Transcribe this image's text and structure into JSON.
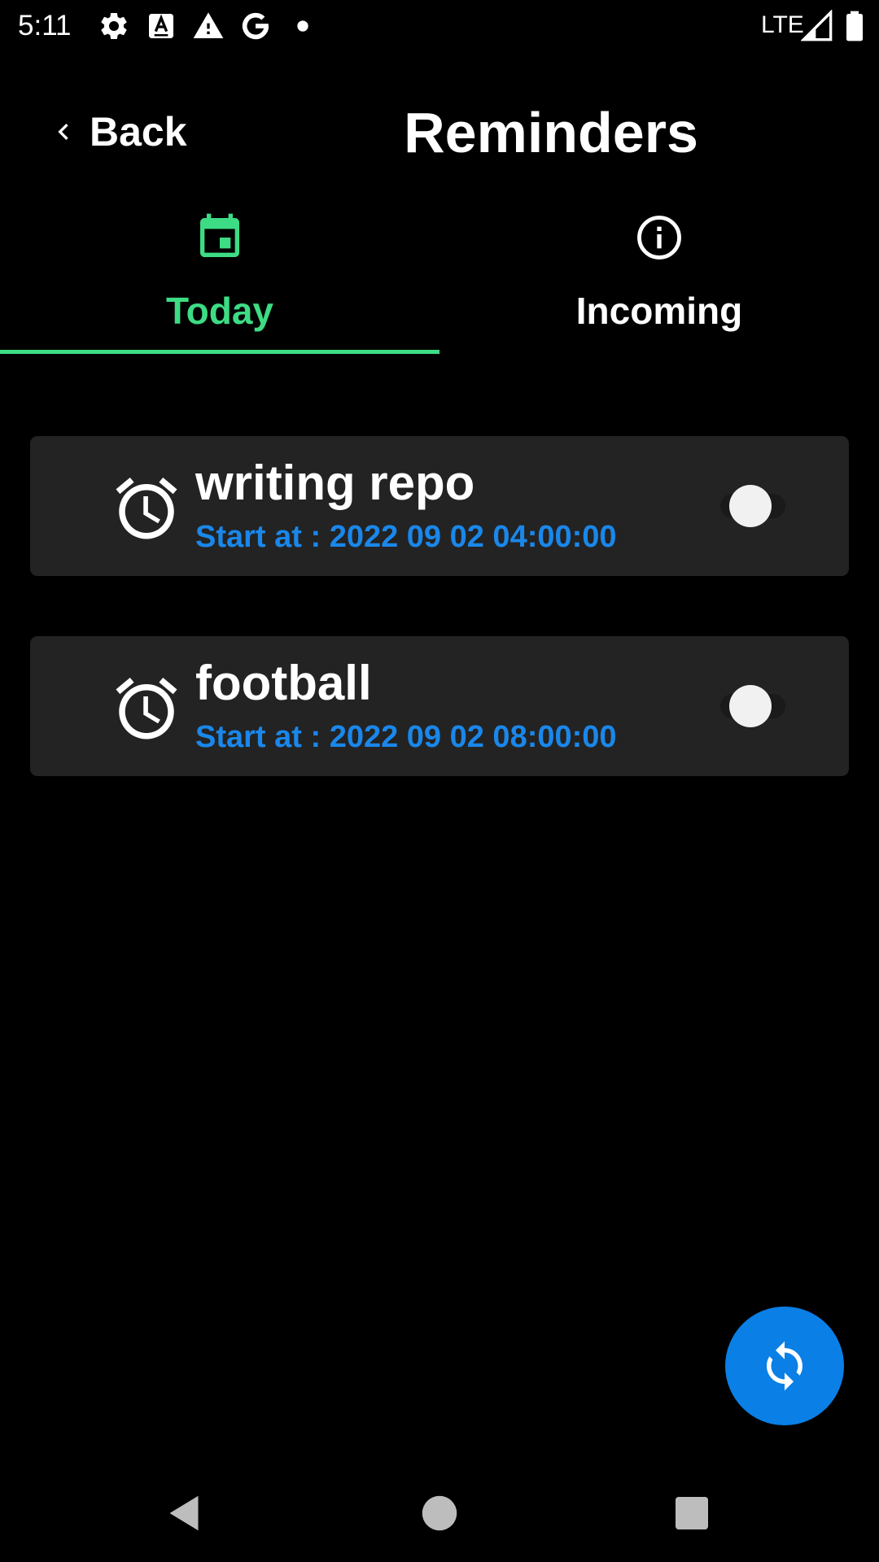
{
  "status_bar": {
    "time": "5:11",
    "network": "LTE",
    "icons": [
      "settings-icon",
      "text-a-icon",
      "warning-icon",
      "google-icon",
      "dot-icon",
      "signal-icon",
      "battery-icon"
    ]
  },
  "header": {
    "back_label": "Back",
    "title": "Reminders"
  },
  "tabs": [
    {
      "label": "Today",
      "icon": "calendar-icon",
      "selected": true
    },
    {
      "label": "Incoming",
      "icon": "info-icon",
      "selected": false
    }
  ],
  "reminders": [
    {
      "title": "writing repo",
      "subtitle": "Start at : 2022 09 02 04:00:00",
      "enabled": false,
      "icon": "alarm-icon"
    },
    {
      "title": "football",
      "subtitle": "Start at : 2022 09 02 08:00:00",
      "enabled": false,
      "icon": "alarm-icon"
    }
  ],
  "fab": {
    "icon": "refresh-icon"
  },
  "nav": {
    "icons": [
      "nav-back-icon",
      "nav-home-icon",
      "nav-recents-icon"
    ]
  },
  "colors": {
    "accent_green": "#3ddc84",
    "accent_blue": "#1a87ea",
    "fab_blue": "#0a7fe6",
    "card_bg": "#232323",
    "background": "#000000"
  }
}
